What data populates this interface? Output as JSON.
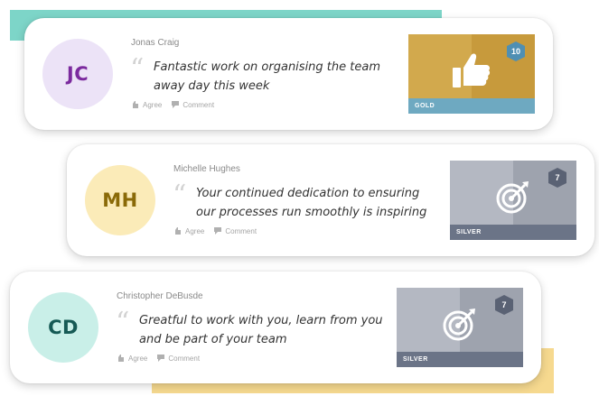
{
  "colors": {
    "teal_accent": "#7dd5c8",
    "yellow_accent": "#f6d98f",
    "gold_badge": "#d2a94d",
    "silver_badge": "#b4b8c2"
  },
  "cards": [
    {
      "initials": "JC",
      "avatar_bg": "#ece3f7",
      "avatar_fg": "#7b2a9e",
      "name": "Jonas Craig",
      "message": "Fantastic work on organising the team away day this week",
      "agree_label": "Agree",
      "comment_label": "Comment",
      "badge": {
        "tier": "GOLD",
        "level": "10",
        "icon": "thumbs-up-icon"
      }
    },
    {
      "initials": "MH",
      "avatar_bg": "#fbebb8",
      "avatar_fg": "#8a6a08",
      "name": "Michelle Hughes",
      "message": "Your continued dedication to ensuring our processes run smoothly is inspiring",
      "agree_label": "Agree",
      "comment_label": "Comment",
      "badge": {
        "tier": "SILVER",
        "level": "7",
        "icon": "target-icon"
      }
    },
    {
      "initials": "CD",
      "avatar_bg": "#c9efe8",
      "avatar_fg": "#165a55",
      "name": "Christopher DeBusde",
      "message": "Greatful to work with you, learn from you and be part of your team",
      "agree_label": "Agree",
      "comment_label": "Comment",
      "badge": {
        "tier": "SILVER",
        "level": "7",
        "icon": "target-icon"
      }
    }
  ]
}
